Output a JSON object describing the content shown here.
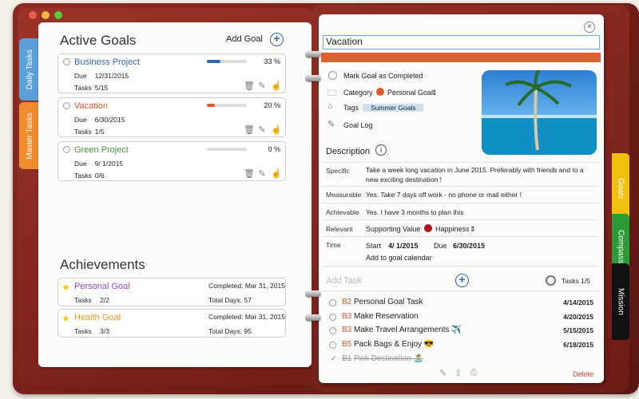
{
  "window": {
    "traffic": [
      "red",
      "yellow",
      "green"
    ]
  },
  "left_tabs": {
    "daily": "Daily Tasks",
    "master": "Master Tasks"
  },
  "active_goals": {
    "title": "Active Goals",
    "add_label": "Add Goal",
    "goals": [
      {
        "name": "Business Project",
        "color": "#2f66b8",
        "due_label": "Due",
        "due": "12/31/2015",
        "tasks_label": "Tasks",
        "tasks": "5/15",
        "percent": "33 %",
        "progress": 0.33,
        "bar_color": "#2f66b8"
      },
      {
        "name": "Vacation",
        "color": "#e0572d",
        "due_label": "Due",
        "due": "6/30/2015",
        "tasks_label": "Tasks",
        "tasks": "1/5",
        "percent": "20 %",
        "progress": 0.2,
        "bar_color": "#e0572d"
      },
      {
        "name": "Green Project",
        "color": "#3a9a3a",
        "due_label": "Due",
        "due": "9/ 1/2015",
        "tasks_label": "Tasks",
        "tasks": "0/6",
        "percent": "0 %",
        "progress": 0.0,
        "bar_color": "#3a9a3a"
      }
    ]
  },
  "achievements": {
    "title": "Achievements",
    "items": [
      {
        "name": "Personal Goal",
        "color": "#9b48b8",
        "tasks_label": "Tasks",
        "tasks": "2/2",
        "completed": "Completed: Mar 31, 2015",
        "days": "Total Days: 57"
      },
      {
        "name": "Health Goal",
        "color": "#e89a1a",
        "tasks_label": "Tasks",
        "tasks": "3/3",
        "completed": "Completed: Mar 31, 2015",
        "days": "Total Days: 95"
      }
    ]
  },
  "detail": {
    "title_value": "Vacation",
    "mark_completed": "Mark Goal as Completed",
    "category_label": "Category",
    "category_value": "Personal Goal",
    "category_color": "#e0572d",
    "tags_label": "Tags",
    "tag": "Summer Goals",
    "goal_log": "Goal Log",
    "description_title": "Description",
    "specific_label": "Specific",
    "specific": "Take a week long vacation in June 2015. Preferably with friends and to a new exciting destination !",
    "measurable_label": "Measurable",
    "measurable": "Yes.  Take 7 days off work - no phone or mail either !",
    "achievable_label": "Achievable",
    "achievable": "Yes.  I have 3 months to plan this",
    "relevant_label": "Relevant",
    "supporting_label": "Supporting Value",
    "supporting_value": "Happiness",
    "supporting_color": "#b0141d",
    "time_label": "Time",
    "start_label": "Start",
    "start": "4/  1/2015",
    "due_label": "Due",
    "due": "6/30/2015",
    "add_calendar": "Add to goal calendar",
    "add_task": "Add Task",
    "tasks_count": "Tasks 1/5",
    "tasks": [
      {
        "code": "B2",
        "name": "Personal Goal Task",
        "date": "4/14/2015",
        "done": false
      },
      {
        "code": "B3",
        "name": "Make Reservation",
        "date": "4/20/2015",
        "done": false
      },
      {
        "code": "B3",
        "name": "Make Travel Arrangements ✈️",
        "date": "5/15/2015",
        "done": false
      },
      {
        "code": "B5",
        "name": "Pack Bags & Enjoy 😎",
        "date": "6/18/2015",
        "done": false
      },
      {
        "code": "B1",
        "name": "Pick Destination 🏝️",
        "date": "",
        "done": true
      }
    ],
    "delete_label": "Delete"
  },
  "right_tabs": {
    "goals": "Goals",
    "compass": "Compass",
    "mission": "Mission"
  },
  "icons": [
    "trash-icon",
    "pencil-icon",
    "hand-icon",
    "folder-icon",
    "tag-icon",
    "edit-icon",
    "info-icon",
    "share-icon",
    "print-icon",
    "target-icon",
    "close-icon"
  ]
}
